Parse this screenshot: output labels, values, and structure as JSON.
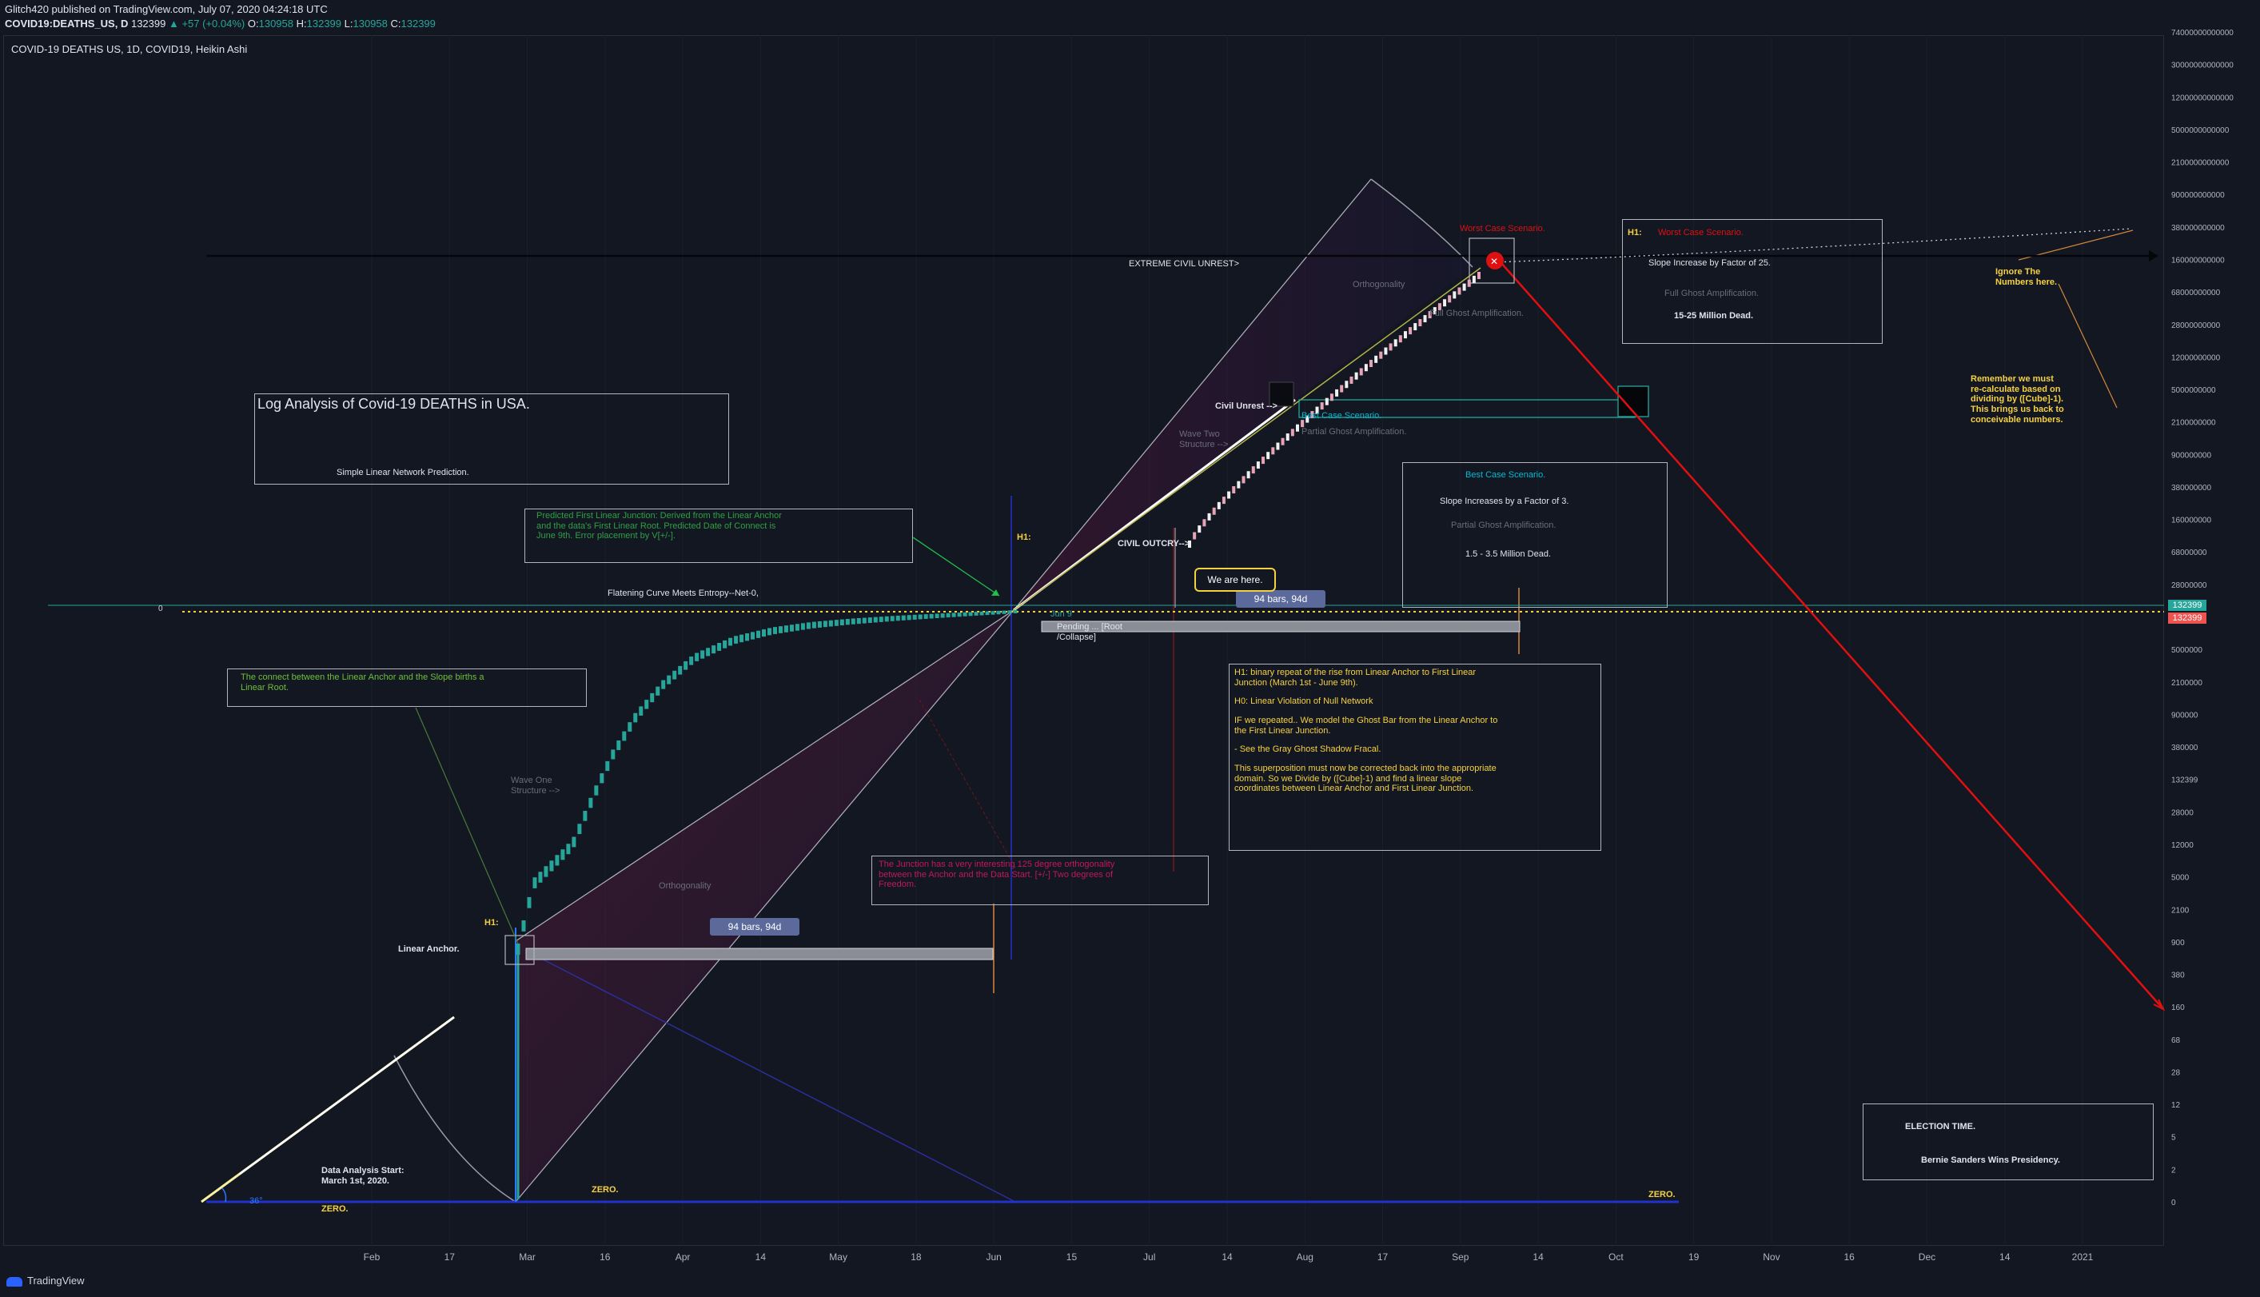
{
  "header": {
    "publisher": "Glitch420 published on TradingView.com, July 07, 2020 04:24:18 UTC",
    "symbol": "COVID19:DEATHS_US, D",
    "last": "132399",
    "change": "▲ +57 (+0.04%)",
    "ohlc_o_label": "O:",
    "ohlc_o": "130958",
    "ohlc_h_label": "H:",
    "ohlc_h": "132399",
    "ohlc_l_label": "L:",
    "ohlc_l": "130958",
    "ohlc_c_label": "C:",
    "ohlc_c": "132399"
  },
  "chart_title": "COVID-19 DEATHS US, 1D, COVID19, Heikin Ashi",
  "brand": "TradingView",
  "colors": {
    "background": "#131722",
    "up": "#26a69a",
    "down": "#ef5350",
    "accent_yellow": "#f5d142",
    "red_line": "#e01010",
    "blue_line": "#2962ff"
  },
  "chart_data": {
    "type": "line",
    "scale": "log",
    "series_style": "Heikin Ashi",
    "x_ticks": [
      "Feb",
      "17",
      "Mar",
      "16",
      "Apr",
      "14",
      "May",
      "18",
      "Jun",
      "15",
      "Jul",
      "14",
      "Aug",
      "17",
      "Sep",
      "14",
      "Oct",
      "19",
      "Nov",
      "16",
      "Dec",
      "14",
      "2021"
    ],
    "y_ticks": [
      "74000000000000",
      "30000000000000",
      "12000000000000",
      "5000000000000",
      "2100000000000",
      "900000000000",
      "380000000000",
      "160000000000",
      "68000000000",
      "28000000000",
      "12000000000",
      "5000000000",
      "2100000000",
      "900000000",
      "380000000",
      "160000000",
      "68000000",
      "28000000",
      "12000000",
      "5000000",
      "2100000",
      "900000",
      "380000",
      "132399",
      "28000",
      "12000",
      "5000",
      "2100",
      "900",
      "380",
      "160",
      "68",
      "28",
      "12",
      "5",
      "2",
      "0"
    ],
    "left_axis_label": "0",
    "price_tags": [
      "132399",
      "132399"
    ],
    "series": [
      {
        "x": [
          "2020-03-01",
          "2020-03-05",
          "2020-03-10",
          "2020-03-15",
          "2020-03-20",
          "2020-03-25",
          "2020-03-31",
          "2020-04-07",
          "2020-04-15",
          "2020-04-25",
          "2020-05-05",
          "2020-05-15",
          "2020-05-25",
          "2020-06-05",
          "2020-06-15",
          "2020-06-25",
          "2020-07-06"
        ],
        "y": [
          1,
          10,
          20,
          40,
          200,
          900,
          3500,
          11000,
          28000,
          52000,
          72000,
          87000,
          98000,
          108000,
          116000,
          124000,
          132399
        ]
      }
    ]
  },
  "annotations": {
    "main_title": "Log Analysis of Covid-19 DEATHS in USA.",
    "main_subtitle": "Simple Linear Network Prediction.",
    "predicted_junction": "Predicted First Linear Junction: Derived from the Linear Anchor and the data's First Linear Root. Predicted Date of Connect is June 9th. Error placement by V[+/-].",
    "flattening": "Flatening Curve Meets Entropy--Net-0,",
    "connect_note": "The connect between the Linear Anchor and the Slope births a Linear Root.",
    "wave_one": "Wave One Structure -->",
    "wave_two": "Wave Two Structure -->",
    "orthogonality_low": "Orthogonality",
    "orthogonality_high": "Orthogonality",
    "h1_left": "H1:",
    "h1_mid": "H1:",
    "linear_anchor": "Linear Anchor.",
    "data_start": "Data Analysis Start: March 1st, 2020.",
    "zero_1": "ZERO.",
    "zero_2": "ZERO.",
    "zero_3": "ZERO.",
    "angle": "36°",
    "bars_94_low": "94 bars, 94d",
    "bars_94_high": "94 bars, 94d",
    "junction_note": "The Junction has a very interesting 125 degree orthogonality between the Anchor and the Data Start. [+/-] Two degrees of Freedom.",
    "extreme_unrest": "EXTREME CIVIL UNREST>",
    "civil_unrest": "Civil Unrest -->",
    "civil_outcry": "CIVIL OUTCRY-->",
    "we_are_here": "We are here.",
    "pending": "Pending ... [Root /Collapse]",
    "best_case_mid": "Best Case Scenario.",
    "partial_ghost_mid": "Partial Ghost Amplification.",
    "worst_case_top": "Worst Case Scenario.",
    "full_ghost_mid": "Full Ghost Amplification.",
    "worst_box": {
      "h1": "H1:",
      "title": "Worst Case Scenario.",
      "line1": "Slope Increase by Factor of 25.",
      "line2": "Full Ghost Amplification.",
      "line3": "15-25 Million Dead."
    },
    "best_box": {
      "title": "Best Case Scenario.",
      "line1": "Slope Increases by a Factor of 3.",
      "line2": "Partial Ghost Amplification.",
      "line3": "1.5 - 3.5 Million Dead."
    },
    "h1_box": {
      "p1": "H1: binary repeat of the rise from Linear Anchor to First Linear Junction (March 1st - June 9th).",
      "p2": "H0: Linear Violation of Null Network",
      "p3": "IF we repeated.. We model the Ghost Bar from the Linear Anchor to the First Linear Junction.",
      "p4": "- See the Gray Ghost Shadow Fracal.",
      "p5": "This superposition must now be corrected back into the appropriate domain. So we Divide by ([Cube]-1) and find a linear slope coordinates between Linear Anchor and First Linear Junction."
    },
    "ignore": "Ignore The Numbers here.",
    "remember": "Remember we must re-calculate based on dividing by ([Cube]-1). This brings us back to conceivable numbers.",
    "election_title": "ELECTION TIME.",
    "election_text": "Bernie Sanders Wins Presidency.",
    "jun9_label": "Jun 9"
  }
}
